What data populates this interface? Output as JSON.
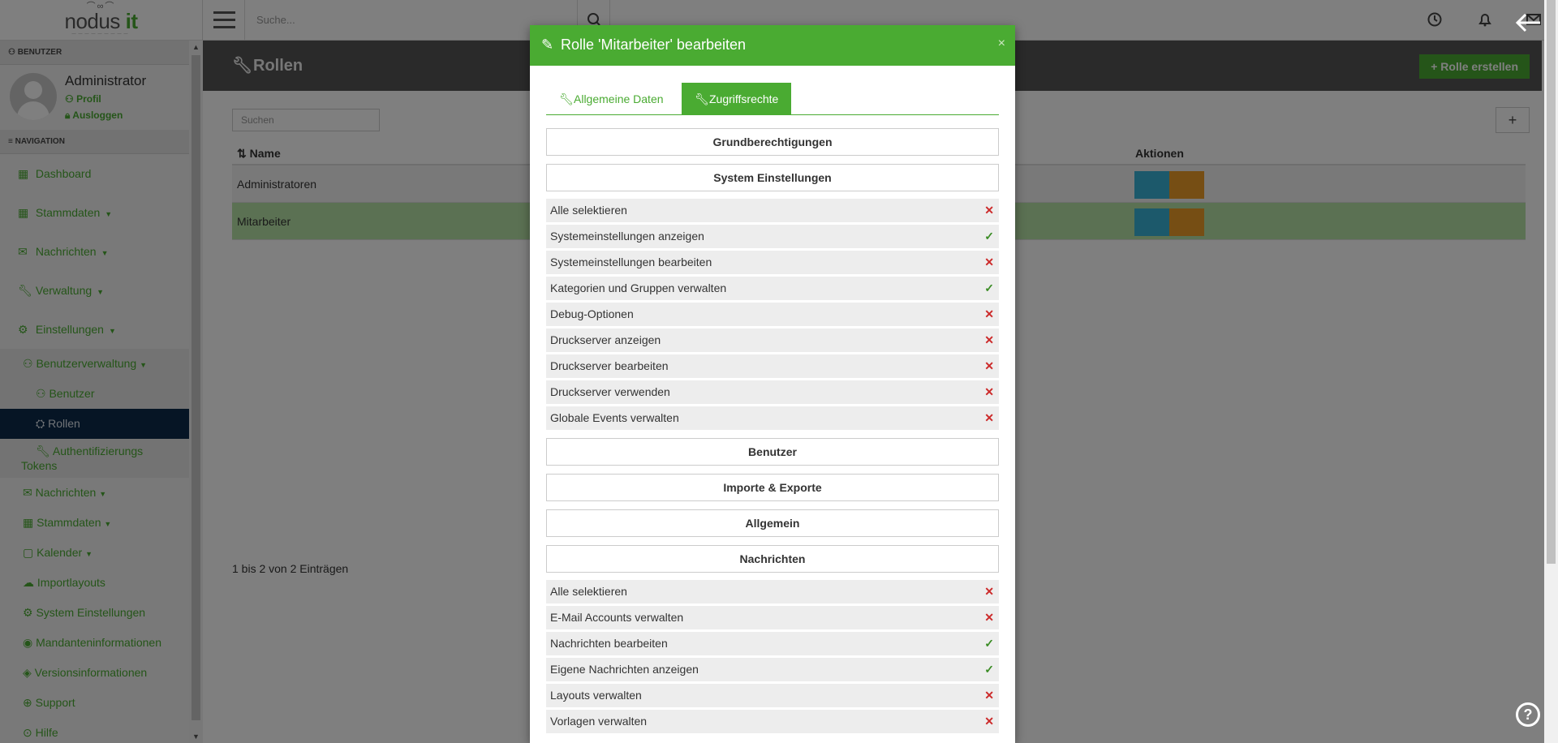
{
  "brand": {
    "name_main": "nodus",
    "name_accent": "it"
  },
  "search": {
    "placeholder": "Suche..."
  },
  "sidebar": {
    "user_section": "BENUTZER",
    "user_name": "Administrator",
    "profile_link": "Profil",
    "logout_link": "Ausloggen",
    "nav_section": "NAVIGATION",
    "items": [
      {
        "label": "Dashboard",
        "icon": "table-icon"
      },
      {
        "label": "Stammdaten",
        "icon": "table-icon",
        "caret": true
      },
      {
        "label": "Nachrichten",
        "icon": "envelope-icon",
        "caret": true
      },
      {
        "label": "Verwaltung",
        "icon": "wrench-icon",
        "caret": true
      },
      {
        "label": "Einstellungen",
        "icon": "gears-icon",
        "caret": true
      }
    ],
    "sub": {
      "benutzerverwaltung": "Benutzerverwaltung",
      "benutzer": "Benutzer",
      "rollen": "Rollen",
      "auth_tokens_1": "Authentifizierungs",
      "auth_tokens_2": "Tokens",
      "nachrichten": "Nachrichten",
      "stammdaten": "Stammdaten",
      "kalender": "Kalender",
      "importlayouts": "Importlayouts",
      "system_einstellungen": "System Einstellungen",
      "mandanteninformationen": "Mandanteninformationen",
      "versionsinformationen": "Versionsinformationen",
      "support": "Support",
      "hilfe": "Hilfe"
    }
  },
  "page": {
    "title": "Rollen",
    "create_button": "Rolle erstellen",
    "search_placeholder": "Suchen",
    "columns": {
      "name": "Name",
      "actions": "Aktionen"
    },
    "rows": [
      "Administratoren",
      "Mitarbeiter"
    ],
    "entries_info": "1 bis 2 von 2 Einträgen"
  },
  "modal": {
    "title": "Rolle 'Mitarbeiter' bearbeiten",
    "close": "×",
    "tabs": [
      "Allgemeine Daten",
      "Zugriffsrechte"
    ],
    "sections": {
      "grund": "Grundberechtigungen",
      "system": "System Einstellungen",
      "benutzer": "Benutzer",
      "importe": "Importe & Exporte",
      "allgemein": "Allgemein",
      "nachrichten": "Nachrichten"
    },
    "system_perms": [
      {
        "label": "Alle selektieren",
        "granted": false
      },
      {
        "label": "Systemeinstellungen anzeigen",
        "granted": true
      },
      {
        "label": "Systemeinstellungen bearbeiten",
        "granted": false
      },
      {
        "label": "Kategorien und Gruppen verwalten",
        "granted": true
      },
      {
        "label": "Debug-Optionen",
        "granted": false
      },
      {
        "label": "Druckserver anzeigen",
        "granted": false
      },
      {
        "label": "Druckserver bearbeiten",
        "granted": false
      },
      {
        "label": "Druckserver verwenden",
        "granted": false
      },
      {
        "label": "Globale Events verwalten",
        "granted": false
      }
    ],
    "message_perms": [
      {
        "label": "Alle selektieren",
        "granted": false
      },
      {
        "label": "E-Mail Accounts verwalten",
        "granted": false
      },
      {
        "label": "Nachrichten bearbeiten",
        "granted": true
      },
      {
        "label": "Eigene Nachrichten anzeigen",
        "granted": true
      },
      {
        "label": "Layouts verwalten",
        "granted": false
      },
      {
        "label": "Vorlagen verwalten",
        "granted": false
      }
    ]
  },
  "colors": {
    "accent": "#4aab32",
    "header": "#555555",
    "active_nav": "#0d2a4a",
    "deny": "#cc2a2a",
    "grant": "#3a8c24"
  }
}
